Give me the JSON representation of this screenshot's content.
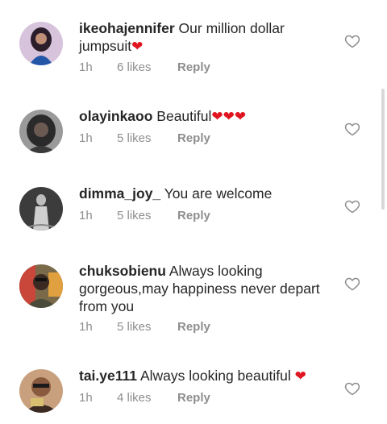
{
  "comments": [
    {
      "username": "ikeohajennifer",
      "text": "Our million dollar jumpsuit",
      "emoji": "❤",
      "time": "1h",
      "likes": "6 likes",
      "reply": "Reply",
      "avatar_colors": [
        "#c9a9d0",
        "#2b1d2a"
      ]
    },
    {
      "username": "olayinkaoo",
      "text": "Beautiful",
      "emoji": "❤❤❤",
      "time": "1h",
      "likes": "5 likes",
      "reply": "Reply",
      "avatar_colors": [
        "#6f6f6f",
        "#2a2a2a"
      ]
    },
    {
      "username": "dimma_joy_",
      "text": "You are welcome",
      "emoji": "",
      "time": "1h",
      "likes": "5 likes",
      "reply": "Reply",
      "avatar_colors": [
        "#bdbdbd",
        "#1d1d1d"
      ]
    },
    {
      "username": "chuksobienu",
      "text": "Always looking gorgeous,may happiness never depart from you",
      "emoji": "",
      "time": "1h",
      "likes": "5 likes",
      "reply": "Reply",
      "avatar_colors": [
        "#d44a3a",
        "#4a4a3a"
      ]
    },
    {
      "username": "tai.ye111",
      "text": "Always looking beautiful",
      "emoji": "❤",
      "time": "1h",
      "likes": "4 likes",
      "reply": "Reply",
      "avatar_colors": [
        "#d6a887",
        "#3a2a22"
      ]
    }
  ],
  "colors": {
    "text": "#262626",
    "meta": "#8e8e8e",
    "heart_emoji": "#e0151f",
    "like_icon_stroke": "#8e8e8e"
  },
  "icons": {
    "like": "heart-outline-icon"
  }
}
